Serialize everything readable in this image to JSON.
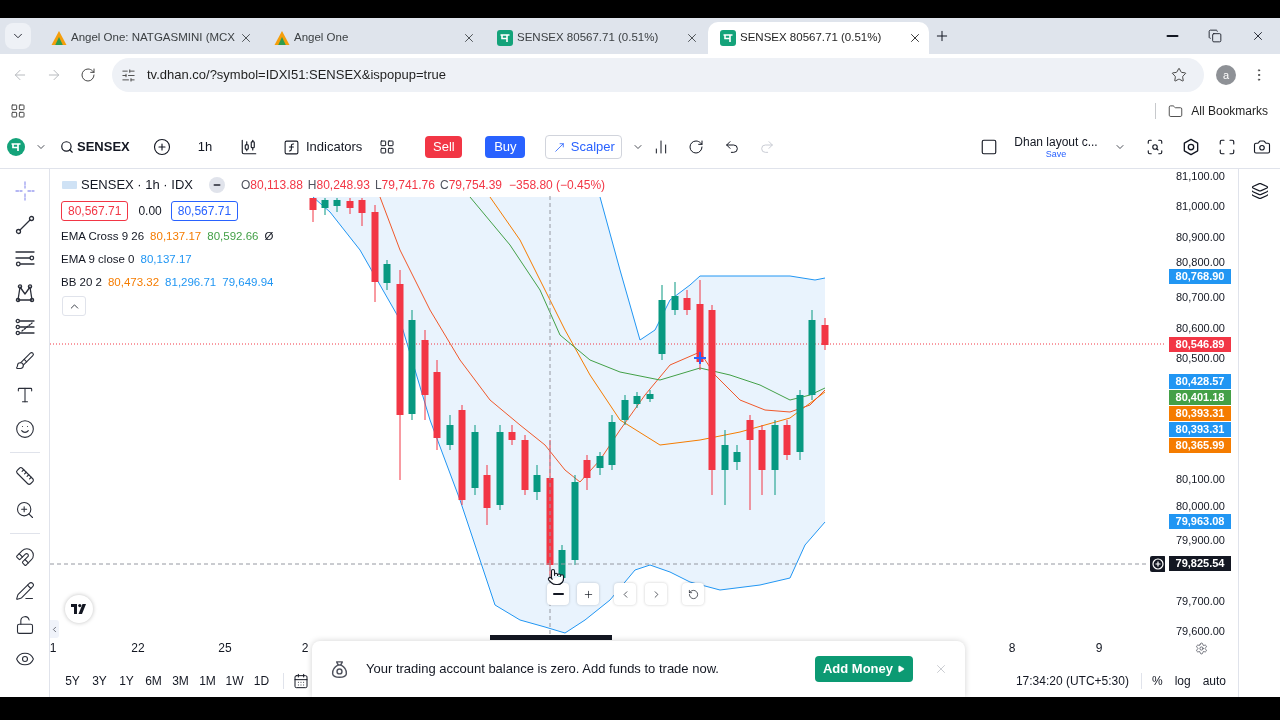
{
  "browser": {
    "tabs": [
      {
        "kind": "angel",
        "title": "Angel One: NATGASMINI (MCX",
        "selected": false
      },
      {
        "kind": "angel",
        "title": "Angel One",
        "selected": false
      },
      {
        "kind": "dhan",
        "title": "SENSEX 80567.71 (0.51%)",
        "selected": false
      },
      {
        "kind": "dhan",
        "title": "SENSEX 80567.71 (0.51%)",
        "selected": true
      }
    ],
    "back": {
      "disabled": true
    },
    "forward": {
      "disabled": true
    },
    "url": "tv.dhan.co/?symbol=IDXI51:SENSEX&ispopup=true",
    "profile": "a",
    "bookmarks_folder": "All Bookmarks"
  },
  "toolbar": {
    "symbol": "SENSEX",
    "interval": "1h",
    "indicators": "Indicators",
    "sell": "Sell",
    "buy": "Buy",
    "scalper": "Scalper",
    "redo": {
      "disabled": true
    },
    "layout": {
      "name": "Dhan layout c...",
      "status": "Save"
    }
  },
  "drawing_tools": [
    {
      "kind": "crosshair",
      "selected": true
    },
    {
      "kind": "trend_line",
      "selected": false
    },
    {
      "kind": "parallel_lines",
      "selected": false
    },
    {
      "kind": "pattern",
      "selected": false
    },
    {
      "kind": "projection",
      "selected": false
    },
    {
      "kind": "brush",
      "selected": false
    },
    {
      "kind": "text",
      "selected": false
    },
    {
      "kind": "emoji",
      "selected": false
    },
    {
      "kind": "ruler",
      "selected": false
    },
    {
      "kind": "zoom",
      "selected": false
    },
    {
      "kind": "magnet",
      "selected": false
    },
    {
      "kind": "drawing_lock",
      "selected": false
    },
    {
      "kind": "lock",
      "selected": false
    },
    {
      "kind": "visibility",
      "selected": false
    }
  ],
  "legend": {
    "title": "SENSEX · 1h · IDX",
    "ohlc": [
      {
        "label": "O",
        "value": "80,113.88"
      },
      {
        "label": "H",
        "value": "80,248.93"
      },
      {
        "label": "L",
        "value": "79,741.76"
      },
      {
        "label": "C",
        "value": "79,754.39"
      }
    ],
    "change": "−358.80 (−0.45%)",
    "sell_price": "80,567.71",
    "spread": "0.00",
    "buy_price": "80,567.71",
    "studies": [
      {
        "name": "EMA Cross 9 26",
        "values": [
          {
            "text": "80,137.17",
            "color": "#f57c00"
          },
          {
            "text": "80,592.66",
            "color": "#43a047"
          }
        ],
        "suffix": "Ø"
      },
      {
        "name": "EMA 9 close 0",
        "values": [
          {
            "text": "80,137.17",
            "color": "#2196f3"
          }
        ]
      },
      {
        "name": "BB 20 2",
        "values": [
          {
            "text": "80,473.32",
            "color": "#f57c00"
          },
          {
            "text": "81,296.71",
            "color": "#2196f3"
          },
          {
            "text": "79,649.94",
            "color": "#2196f3"
          }
        ]
      }
    ]
  },
  "price_axis": {
    "labels": [
      "81,100.00",
      "81,000.00",
      "80,900.00",
      "80,800.00",
      "80,700.00",
      "80,600.00",
      "80,500.00",
      "80,100.00",
      "80,000.00",
      "79,900.00",
      "79,700.00",
      "79,600.00"
    ],
    "tags": [
      {
        "text": "80,768.90",
        "color": "#2196f3"
      },
      {
        "text": "80,546.89",
        "color": "#f23645"
      },
      {
        "text": "80,428.57",
        "color": "#2196f3"
      },
      {
        "text": "80,401.18",
        "color": "#43a047"
      },
      {
        "text": "80,393.31",
        "color": "#f57c00"
      },
      {
        "text": "80,393.31",
        "color": "#2196f3"
      },
      {
        "text": "80,365.99",
        "color": "#f57c00"
      },
      {
        "text": "79,963.08",
        "color": "#2196f3"
      }
    ],
    "crosshair": "79,825.54"
  },
  "time_axis": [
    "1",
    "22",
    "25",
    "2",
    "8",
    "9"
  ],
  "notice": {
    "message": "Your trading account balance is zero. Add funds to trade now.",
    "action": "Add Money"
  },
  "ranges": [
    "5Y",
    "3Y",
    "1Y",
    "6M",
    "3M",
    "1M",
    "1W",
    "1D"
  ],
  "clock": "17:34:20 (UTC+5:30)",
  "scale": [
    "%",
    "log",
    "auto"
  ]
}
